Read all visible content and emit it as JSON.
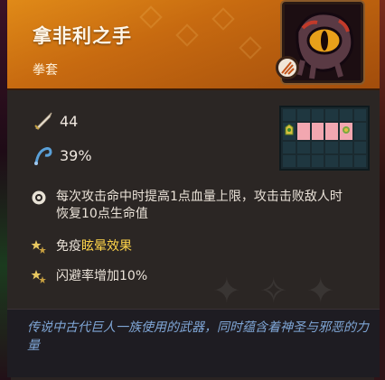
{
  "item": {
    "name": "拿非利之手",
    "type": "拳套",
    "portrait_icon": "demon-eye-fist-icon",
    "badge_icon": "claw-slash-icon"
  },
  "stats": [
    {
      "icon": "sword-icon",
      "value": "44"
    },
    {
      "icon": "whip-crit-icon",
      "value": "39%"
    }
  ],
  "grid": {
    "cols": 6,
    "rows": 4,
    "cells": [
      0,
      0,
      0,
      0,
      0,
      0,
      1,
      2,
      2,
      2,
      3,
      0,
      0,
      0,
      0,
      0,
      0,
      0,
      0,
      0,
      0,
      0,
      0,
      0
    ]
  },
  "effects": {
    "e1": {
      "icon": "target-icon",
      "text": "每次攻击命中时提高1点血量上限，攻击击败敌人时恢复10点生命值"
    },
    "e2": {
      "icon": "stars-icon",
      "prefix": "免疫",
      "highlight": "眩晕效果"
    },
    "e3": {
      "icon": "stars-icon",
      "prefix": "闪避率",
      "suffix": "增加10%"
    }
  },
  "flavor_text": "传说中古代巨人一族使用的武器，同时蕴含着神圣与邪恶的力量",
  "colors": {
    "header": "#d77a14",
    "highlight": "#ffd44a",
    "flavor": "#7fa6d6",
    "grid_active": "#f2a7b0"
  }
}
